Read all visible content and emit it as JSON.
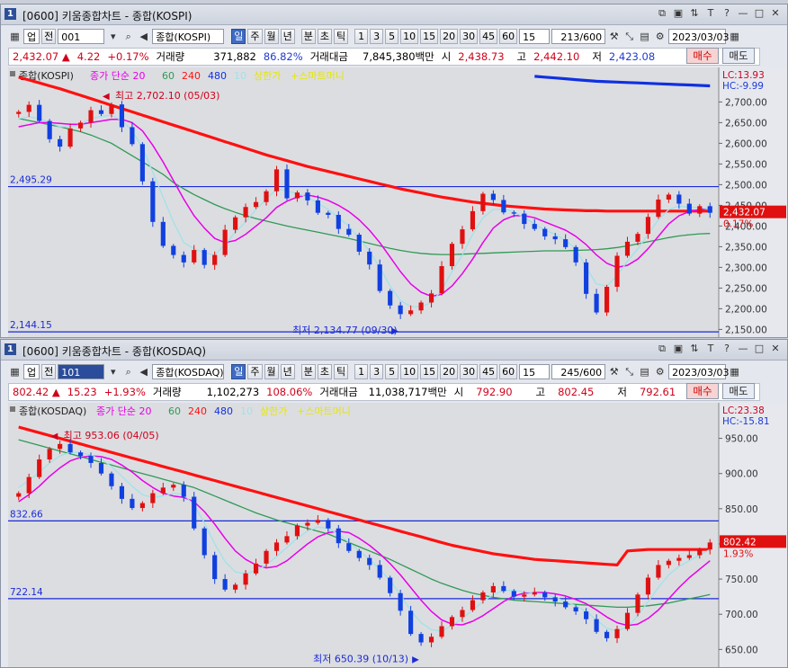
{
  "windows": [
    {
      "id": "kospi",
      "title": {
        "num": "1",
        "text": "[0600] 키움종합차트 - 종합(KOSPI)"
      },
      "toolbar": {
        "kind": "업",
        "prefix": "전",
        "code": "001",
        "name": "종합(KOSPI)",
        "periods": [
          "일",
          "주",
          "월",
          "년",
          "분",
          "초",
          "틱"
        ],
        "active_period": "일",
        "intervals": [
          "1",
          "3",
          "5",
          "10",
          "15",
          "20",
          "30",
          "45",
          "60"
        ],
        "interval_value": "15",
        "count": "213/600",
        "date": "2023/03/03"
      },
      "quote": {
        "price": "2,432.07",
        "arrow": "▲",
        "change": "4.22",
        "rate": "+0.17%",
        "volume_label": "거래량",
        "volume": "371,882",
        "volume_rate": "86.82%",
        "amount_label": "거래대금",
        "amount": "7,845,380백만",
        "open_label": "시",
        "open": "2,438.73",
        "high_label": "고",
        "high": "2,442.10",
        "low_label": "저",
        "low": "2,423.08",
        "buy": "매수",
        "sell": "매도"
      },
      "legend": {
        "name": "종합(KOSPI)",
        "ma_label": "종가 단순",
        "ma": [
          "20",
          "60",
          "240",
          "480",
          "10"
        ],
        "upper_limit": "상한가",
        "smart": "+스마트머니",
        "lc": "LC:13.93",
        "hc": "HC:-9.99"
      },
      "annotations": {
        "high": "최고 2,702.10 (05/03)",
        "low": "최저 2,134.77 (09/30)",
        "line1": "2,495.29",
        "line2": "2,144.15",
        "price_tag": "2,432.07",
        "rate_tag": "0.17%"
      },
      "chart_data": {
        "type": "candlestick",
        "title": "종합(KOSPI)",
        "ylim": [
          2140,
          2740
        ],
        "y_ticks": [
          "2,700.00",
          "2,650.00",
          "2,600.00",
          "2,550.00",
          "2,500.00",
          "2,450.00",
          "2,400.00",
          "2,350.00",
          "2,300.00",
          "2,250.00",
          "2,200.00",
          "2,150.00"
        ],
        "closes": [
          2676,
          2693,
          2654,
          2610,
          2592,
          2636,
          2650,
          2680,
          2671,
          2694,
          2639,
          2598,
          2508,
          2410,
          2352,
          2330,
          2312,
          2342,
          2306,
          2330,
          2391,
          2421,
          2446,
          2458,
          2484,
          2537,
          2467,
          2481,
          2462,
          2432,
          2427,
          2393,
          2379,
          2338,
          2307,
          2243,
          2208,
          2187,
          2196,
          2215,
          2237,
          2303,
          2357,
          2392,
          2436,
          2478,
          2463,
          2433,
          2430,
          2405,
          2393,
          2375,
          2368,
          2349,
          2312,
          2236,
          2191,
          2253,
          2328,
          2362,
          2381,
          2422,
          2464,
          2476,
          2454,
          2430,
          2448,
          2432
        ],
        "horizontal_lines": [
          2495.29,
          2144.15
        ],
        "ma_values": {
          "10": [
            2660,
            2664,
            2660,
            2650,
            2640,
            2640,
            2645,
            2660,
            2665,
            2668,
            2655,
            2630,
            2590,
            2530,
            2470,
            2410,
            2360,
            2345,
            2335,
            2330,
            2355,
            2385,
            2410,
            2440,
            2465,
            2490,
            2485,
            2478,
            2470,
            2455,
            2440,
            2420,
            2400,
            2370,
            2340,
            2300,
            2255,
            2220,
            2205,
            2205,
            2215,
            2245,
            2290,
            2330,
            2380,
            2420,
            2440,
            2440,
            2435,
            2420,
            2405,
            2390,
            2380,
            2365,
            2345,
            2300,
            2260,
            2255,
            2280,
            2315,
            2345,
            2380,
            2415,
            2440,
            2448,
            2445,
            2445,
            2440
          ],
          "20": [
            2640,
            2645,
            2650,
            2650,
            2648,
            2646,
            2646,
            2650,
            2654,
            2658,
            2658,
            2650,
            2630,
            2595,
            2555,
            2510,
            2465,
            2425,
            2395,
            2370,
            2360,
            2365,
            2380,
            2400,
            2420,
            2445,
            2460,
            2470,
            2475,
            2470,
            2462,
            2450,
            2435,
            2415,
            2390,
            2360,
            2325,
            2290,
            2260,
            2240,
            2230,
            2235,
            2255,
            2285,
            2320,
            2360,
            2395,
            2415,
            2425,
            2425,
            2420,
            2410,
            2400,
            2390,
            2375,
            2355,
            2330,
            2310,
            2300,
            2305,
            2320,
            2345,
            2375,
            2405,
            2425,
            2435,
            2440,
            2442
          ],
          "60": [
            2660,
            2655,
            2650,
            2645,
            2640,
            2634,
            2628,
            2620,
            2610,
            2600,
            2585,
            2570,
            2555,
            2540,
            2525,
            2505,
            2490,
            2476,
            2464,
            2452,
            2442,
            2433,
            2425,
            2418,
            2412,
            2406,
            2400,
            2395,
            2390,
            2385,
            2380,
            2375,
            2370,
            2364,
            2358,
            2352,
            2346,
            2341,
            2337,
            2334,
            2332,
            2331,
            2331,
            2332,
            2333,
            2334,
            2335,
            2336,
            2337,
            2338,
            2339,
            2340,
            2340,
            2340,
            2341,
            2342,
            2343,
            2345,
            2348,
            2352,
            2357,
            2362,
            2367,
            2372,
            2376,
            2379,
            2381,
            2382
          ],
          "240": [
            2760,
            2753,
            2746,
            2739,
            2732,
            2724,
            2716,
            2708,
            2700,
            2692,
            2684,
            2676,
            2668,
            2660,
            2652,
            2644,
            2636,
            2628,
            2620,
            2612,
            2604,
            2596,
            2588,
            2580,
            2572,
            2565,
            2558,
            2551,
            2544,
            2538,
            2532,
            2526,
            2520,
            2514,
            2508,
            2502,
            2496,
            2490,
            2485,
            2480,
            2475,
            2470,
            2466,
            2462,
            2458,
            2455,
            2452,
            2449,
            2447,
            2445,
            2443,
            2441,
            2440,
            2439,
            2438,
            2437,
            2437,
            2436,
            2436,
            2436,
            2436,
            2436,
            2436,
            2436,
            2436,
            2436,
            2436,
            2436
          ],
          "480": [
            null,
            null,
            null,
            null,
            null,
            null,
            null,
            null,
            null,
            null,
            null,
            null,
            null,
            null,
            null,
            null,
            null,
            null,
            null,
            null,
            null,
            null,
            null,
            null,
            null,
            null,
            null,
            null,
            null,
            null,
            null,
            null,
            null,
            null,
            null,
            null,
            null,
            null,
            null,
            null,
            null,
            null,
            null,
            null,
            null,
            null,
            null,
            null,
            null,
            null,
            2762,
            2760,
            2758,
            2756,
            2754,
            2752,
            2750,
            2749,
            2748,
            2747,
            2746,
            2745,
            2744,
            2743,
            2742,
            2741,
            2740,
            2739
          ]
        }
      }
    },
    {
      "id": "kosdaq",
      "title": {
        "num": "1",
        "text": "[0600] 키움종합차트 - 종합(KOSDAQ)"
      },
      "toolbar": {
        "kind": "업",
        "prefix": "전",
        "code": "101",
        "name": "종합(KOSDAQ)",
        "periods": [
          "일",
          "주",
          "월",
          "년",
          "분",
          "초",
          "틱"
        ],
        "active_period": "일",
        "intervals": [
          "1",
          "3",
          "5",
          "10",
          "15",
          "20",
          "30",
          "45",
          "60"
        ],
        "interval_value": "15",
        "count": "245/600",
        "date": "2023/03/03"
      },
      "quote": {
        "price": "802.42",
        "arrow": "▲",
        "change": "15.23",
        "rate": "+1.93%",
        "volume_label": "거래량",
        "volume": "1,102,273",
        "volume_rate": "108.06%",
        "amount_label": "거래대금",
        "amount": "11,038,717백만",
        "open_label": "시",
        "open": "792.90",
        "high_label": "고",
        "high": "802.45",
        "low_label": "저",
        "low": "792.61",
        "buy": "매수",
        "sell": "매도"
      },
      "legend": {
        "name": "종합(KOSDAQ)",
        "ma_label": "종가 단순",
        "ma": [
          "20",
          "60",
          "240",
          "480",
          "10"
        ],
        "upper_limit": "상한가",
        "smart": "+스마트머니",
        "lc": "LC:23.38",
        "hc": "HC:-15.81"
      },
      "annotations": {
        "high": "최고 953.06 (04/05)",
        "low": "최저 650.39 (10/13)",
        "line1": "832.66",
        "line2": "722.14",
        "price_tag": "802.42",
        "rate_tag": "1.93%"
      },
      "chart_data": {
        "type": "candlestick",
        "title": "종합(KOSDAQ)",
        "ylim": [
          630,
          975
        ],
        "y_ticks": [
          "950.00",
          "900.00",
          "850.00",
          "800.00",
          "750.00",
          "700.00",
          "650.00"
        ],
        "closes": [
          872,
          895,
          920,
          935,
          942,
          930,
          925,
          915,
          900,
          882,
          864,
          851,
          858,
          872,
          880,
          884,
          867,
          822,
          784,
          750,
          735,
          742,
          758,
          772,
          790,
          802,
          811,
          826,
          830,
          834,
          822,
          801,
          790,
          780,
          770,
          752,
          730,
          705,
          672,
          660,
          668,
          683,
          696,
          706,
          720,
          731,
          740,
          733,
          725,
          728,
          731,
          724,
          718,
          710,
          704,
          693,
          675,
          666,
          679,
          702,
          728,
          752,
          770,
          776,
          780,
          784,
          792,
          802
        ],
        "horizontal_lines": [
          832.66,
          722.14
        ],
        "ma_values": {
          "10": [
            880,
            890,
            902,
            915,
            925,
            930,
            930,
            926,
            920,
            910,
            896,
            882,
            870,
            866,
            868,
            872,
            870,
            855,
            830,
            800,
            775,
            760,
            758,
            762,
            770,
            782,
            795,
            808,
            818,
            824,
            822,
            814,
            802,
            790,
            778,
            764,
            748,
            728,
            705,
            688,
            678,
            676,
            684,
            694,
            706,
            718,
            728,
            734,
            734,
            732,
            730,
            728,
            724,
            718,
            712,
            704,
            692,
            680,
            676,
            682,
            698,
            718,
            738,
            756,
            768,
            776,
            784,
            792
          ],
          "20": [
            860,
            870,
            882,
            896,
            908,
            918,
            923,
            925,
            924,
            920,
            912,
            902,
            890,
            880,
            872,
            868,
            866,
            860,
            846,
            828,
            808,
            790,
            778,
            770,
            766,
            768,
            776,
            788,
            800,
            810,
            816,
            818,
            816,
            808,
            798,
            786,
            772,
            756,
            738,
            720,
            704,
            692,
            686,
            685,
            690,
            698,
            708,
            718,
            726,
            730,
            731,
            731,
            729,
            726,
            721,
            715,
            706,
            696,
            688,
            684,
            686,
            694,
            706,
            722,
            738,
            752,
            764,
            776
          ],
          "60": [
            948,
            944,
            940,
            936,
            932,
            928,
            924,
            920,
            916,
            912,
            908,
            904,
            900,
            896,
            892,
            888,
            884,
            880,
            874,
            868,
            862,
            856,
            850,
            844,
            839,
            834,
            830,
            826,
            822,
            818,
            814,
            808,
            802,
            796,
            790,
            784,
            778,
            771,
            764,
            757,
            750,
            744,
            739,
            734,
            730,
            727,
            724,
            722,
            720,
            719,
            718,
            717,
            716,
            715,
            714,
            713,
            712,
            711,
            710,
            710,
            711,
            712,
            714,
            716,
            719,
            722,
            725,
            728
          ],
          "240": [
            966,
            962,
            958,
            954,
            950,
            946,
            942,
            938,
            934,
            930,
            926,
            922,
            918,
            914,
            910,
            906,
            902,
            898,
            894,
            890,
            886,
            882,
            878,
            874,
            870,
            866,
            862,
            858,
            854,
            850,
            846,
            842,
            838,
            834,
            830,
            826,
            822,
            818,
            814,
            810,
            806,
            802,
            798,
            795,
            792,
            789,
            786,
            784,
            782,
            780,
            778,
            777,
            776,
            775,
            774,
            773,
            772,
            771,
            770,
            790,
            791,
            792,
            792,
            792,
            792,
            792,
            792,
            792
          ],
          "480": [
            null,
            null,
            null,
            null,
            null,
            null,
            null,
            null,
            null,
            null,
            null,
            null,
            null,
            null,
            null,
            null,
            null,
            null,
            null,
            null,
            null,
            null,
            null,
            null,
            null,
            null,
            null,
            null,
            null,
            null,
            null,
            null,
            null,
            null,
            null,
            null,
            null,
            null,
            null,
            null,
            null,
            null,
            null,
            null,
            null,
            null,
            null,
            null,
            null,
            null,
            null,
            null,
            null,
            null,
            null,
            null,
            null,
            null,
            null,
            null,
            null,
            null,
            null,
            null,
            null,
            null,
            null,
            null
          ]
        }
      }
    }
  ],
  "ui_colors": {
    "ma10": "#9fe3e8",
    "ma20": "#e800e8",
    "ma60": "#2f9a55",
    "ma240": "#ff1010",
    "ma480": "#1030e0",
    "up": "#e01010",
    "down": "#1040e0",
    "hline": "#1a2bd8"
  }
}
